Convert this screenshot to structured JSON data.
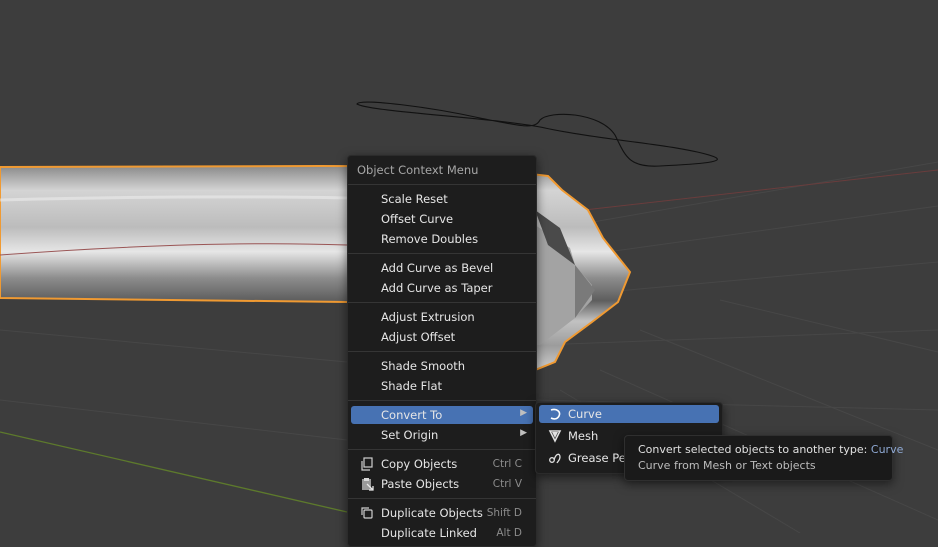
{
  "context_menu": {
    "title": "Object Context Menu",
    "items": [
      {
        "label": "Scale Reset"
      },
      {
        "label": "Offset Curve"
      },
      {
        "label": "Remove Doubles"
      },
      {
        "label": "Add Curve as Bevel"
      },
      {
        "label": "Add Curve as Taper"
      },
      {
        "label": "Adjust Extrusion"
      },
      {
        "label": "Adjust Offset"
      },
      {
        "label": "Shade Smooth"
      },
      {
        "label": "Shade Flat"
      },
      {
        "label": "Convert To"
      },
      {
        "label": "Set Origin"
      },
      {
        "label": "Copy Objects",
        "shortcut": "Ctrl C",
        "icon": "copy-icon"
      },
      {
        "label": "Paste Objects",
        "shortcut": "Ctrl V",
        "icon": "paste-icon"
      },
      {
        "label": "Duplicate Objects",
        "shortcut": "Shift D",
        "icon": "duplicate-icon"
      },
      {
        "label": "Duplicate Linked",
        "shortcut": "Alt D"
      }
    ]
  },
  "submenu": {
    "items": [
      {
        "label": "Curve",
        "icon": "curve-icon"
      },
      {
        "label": "Mesh",
        "icon": "mesh-icon"
      },
      {
        "label": "Grease Pencil",
        "icon": "grease-pencil-icon"
      }
    ]
  },
  "tooltip": {
    "line1": "Convert selected objects to another type:",
    "line1_value": "Curve",
    "line2": "Curve from Mesh or Text objects"
  },
  "colors": {
    "accent": "#4772b3",
    "selection_outline": "#f09a32",
    "background": "#3d3d3d"
  }
}
